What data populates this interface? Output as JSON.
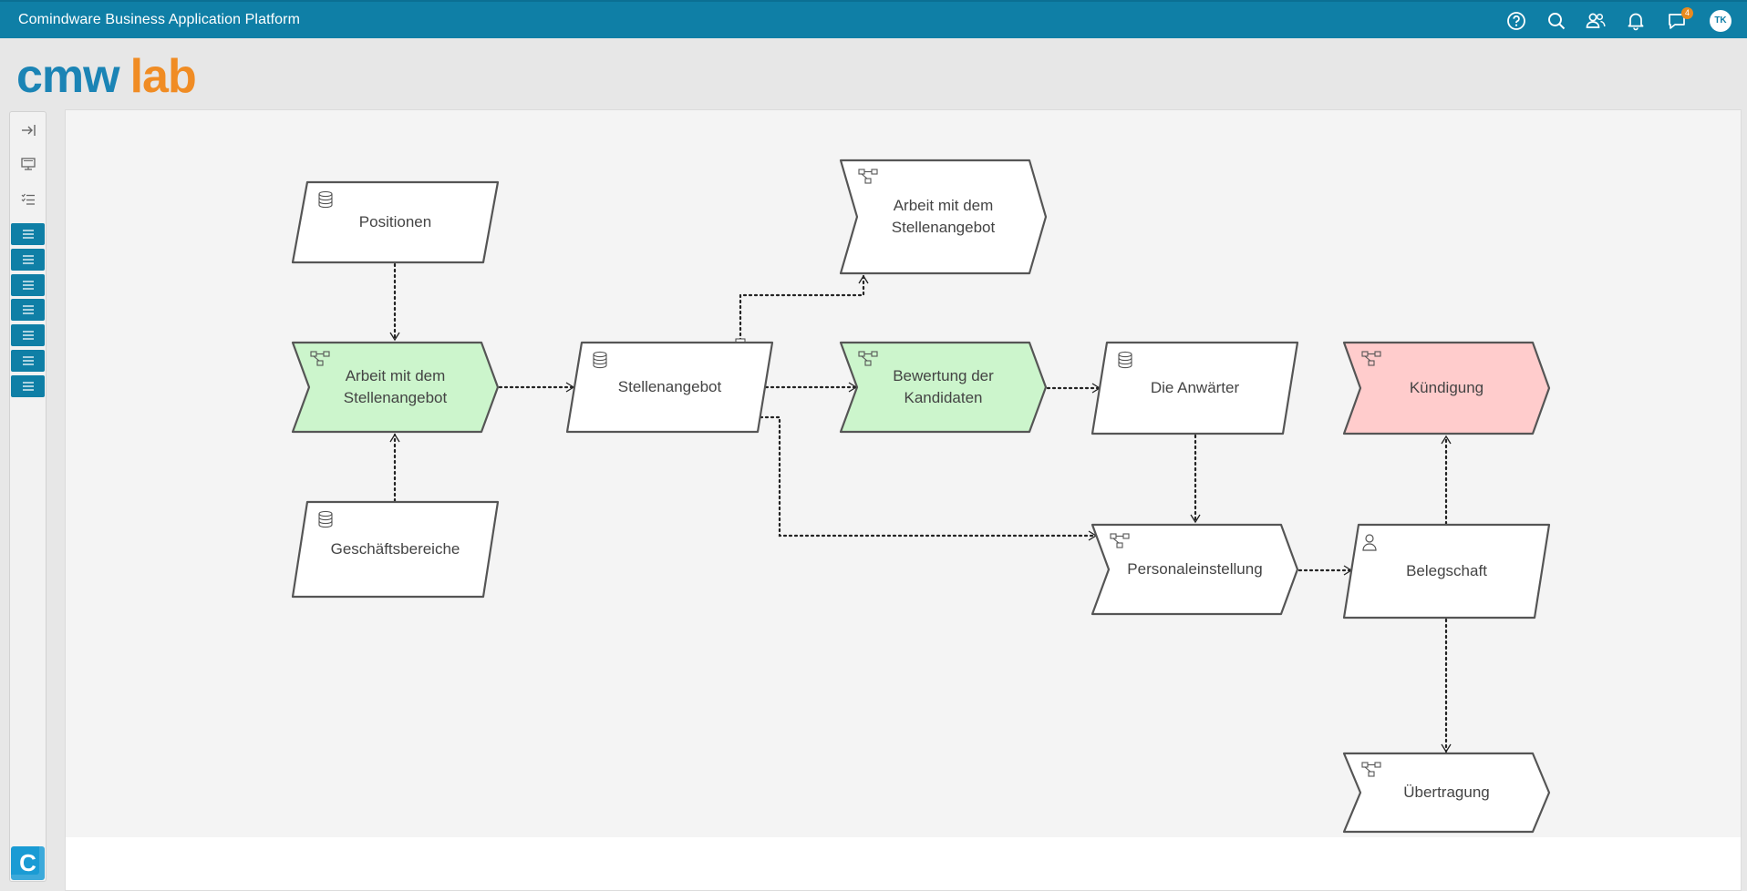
{
  "header": {
    "title": "Comindware Business Application Platform",
    "notification_count": "4",
    "avatar_initials": "TK"
  },
  "header_icons": [
    "help-icon",
    "search-icon",
    "users-icon",
    "bell-icon",
    "chat-icon"
  ],
  "logo": {
    "part1": "cmw",
    "part2": "lab"
  },
  "sidebar": {
    "tools": [
      "collapse-icon",
      "monitor-icon",
      "checklist-icon"
    ],
    "items": [
      "list-icon",
      "list-icon",
      "list-icon",
      "list-icon",
      "list-icon",
      "list-icon",
      "list-icon"
    ]
  },
  "colors": {
    "header": "#0f7fa6",
    "green_fill": "#ccf5cc",
    "red_fill": "#ffcccc",
    "white_fill": "#ffffff",
    "accent_orange": "#f08c24"
  },
  "nodes": [
    {
      "id": "positionen",
      "label": "Positionen",
      "kind": "data",
      "fill": "white"
    },
    {
      "id": "arbeit1",
      "label": "Arbeit mit dem Stellenangebot",
      "kind": "process",
      "fill": "green"
    },
    {
      "id": "geschaeftsbereiche",
      "label": "Geschäftsbereiche",
      "kind": "data",
      "fill": "white"
    },
    {
      "id": "stellenangebot",
      "label": "Stellenangebot",
      "kind": "data",
      "fill": "white"
    },
    {
      "id": "arbeit2",
      "label": "Arbeit mit dem Stellenangebot",
      "kind": "process",
      "fill": "white"
    },
    {
      "id": "bewertung",
      "label": "Bewertung der Kandidaten",
      "kind": "process",
      "fill": "green"
    },
    {
      "id": "anwaerter",
      "label": "Die Anwärter",
      "kind": "data",
      "fill": "white"
    },
    {
      "id": "kuendigung",
      "label": "Kündigung",
      "kind": "process",
      "fill": "red"
    },
    {
      "id": "personaleinstellung",
      "label": "Personaleinstellung",
      "kind": "process",
      "fill": "white"
    },
    {
      "id": "belegschaft",
      "label": "Belegschaft",
      "kind": "person",
      "fill": "white"
    },
    {
      "id": "uebertragung",
      "label": "Übertragung",
      "kind": "process",
      "fill": "white"
    }
  ],
  "edges": [
    {
      "from": "positionen",
      "to": "arbeit1"
    },
    {
      "from": "geschaeftsbereiche",
      "to": "arbeit1"
    },
    {
      "from": "arbeit1",
      "to": "stellenangebot"
    },
    {
      "from": "stellenangebot",
      "to": "arbeit2"
    },
    {
      "from": "stellenangebot",
      "to": "bewertung"
    },
    {
      "from": "stellenangebot",
      "to": "personaleinstellung"
    },
    {
      "from": "bewertung",
      "to": "anwaerter"
    },
    {
      "from": "anwaerter",
      "to": "personaleinstellung"
    },
    {
      "from": "personaleinstellung",
      "to": "belegschaft"
    },
    {
      "from": "belegschaft",
      "to": "kuendigung"
    },
    {
      "from": "belegschaft",
      "to": "uebertragung"
    }
  ]
}
